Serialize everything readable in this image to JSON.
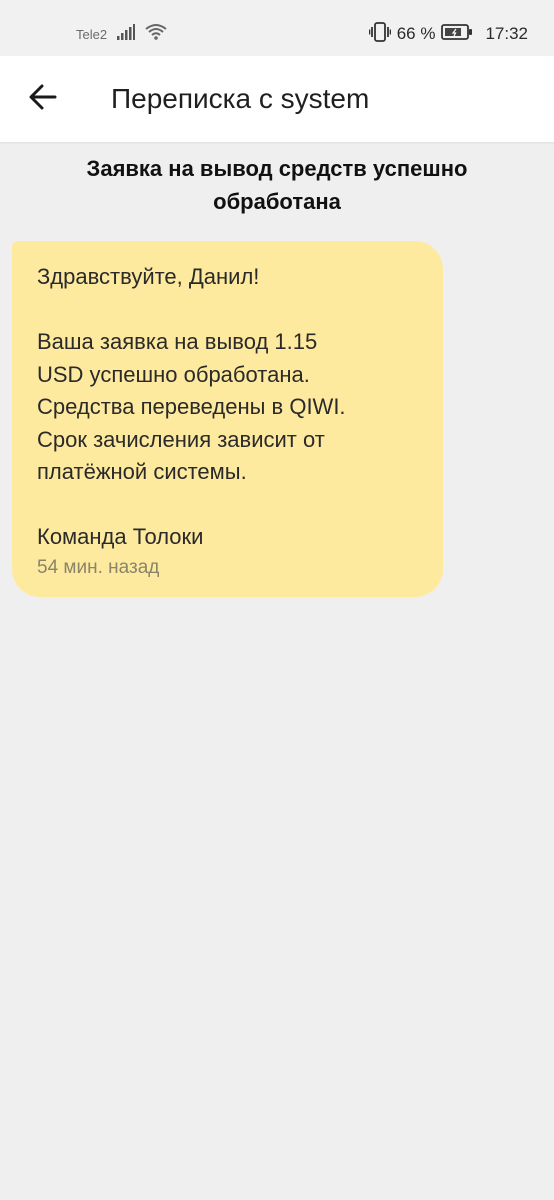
{
  "status_bar": {
    "carrier": "Tele2",
    "battery_percent": "66 %",
    "time": "17:32",
    "icons": [
      "signal-icon",
      "wifi-icon",
      "vibrate-icon",
      "battery-icon"
    ]
  },
  "header": {
    "back_icon": "arrow-left-icon",
    "title": "Переписка с system"
  },
  "thread": {
    "subject": "Заявка на вывод средств успешно обработана"
  },
  "message": {
    "body": "Здравствуйте, Данил!\n\nВаша заявка на вывод 1.15\nUSD успешно обработана.\nСредства переведены в QIWI.\nСрок зачисления зависит от\nплатёжной системы.\n\nКоманда Толоки",
    "time": "54 мин. назад",
    "bubble_color": "#feea9e"
  },
  "colors": {
    "background": "#efefef",
    "header_background": "#ffffff",
    "status_bar_background": "#f1f1f1"
  }
}
